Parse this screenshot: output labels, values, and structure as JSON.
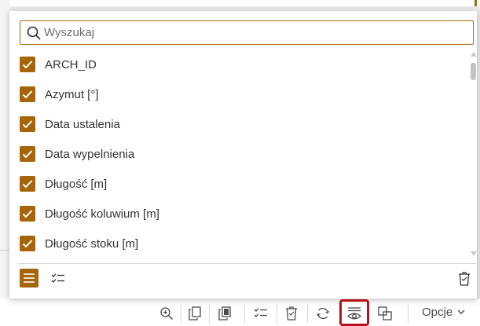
{
  "search": {
    "placeholder": "Wyszukaj",
    "value": ""
  },
  "fields": [
    {
      "label": "ARCH_ID",
      "checked": true
    },
    {
      "label": "Azymut [°]",
      "checked": true
    },
    {
      "label": "Data ustalenia",
      "checked": true
    },
    {
      "label": "Data wypelnienia",
      "checked": true
    },
    {
      "label": "Długość [m]",
      "checked": true
    },
    {
      "label": "Długość koluwium [m]",
      "checked": true
    },
    {
      "label": "Długość stoku [m]",
      "checked": true
    }
  ],
  "toolbar": {
    "buttons": [
      "zoom-in-icon",
      "copy-icon",
      "copy-selected-icon",
      "check-list-icon",
      "delete-icon",
      "refresh-icon",
      "show-hide-fields-icon",
      "duplicate-icon"
    ],
    "options_label": "Opcje"
  },
  "colors": {
    "accent": "#a5660b",
    "highlight": "#b5121b"
  }
}
